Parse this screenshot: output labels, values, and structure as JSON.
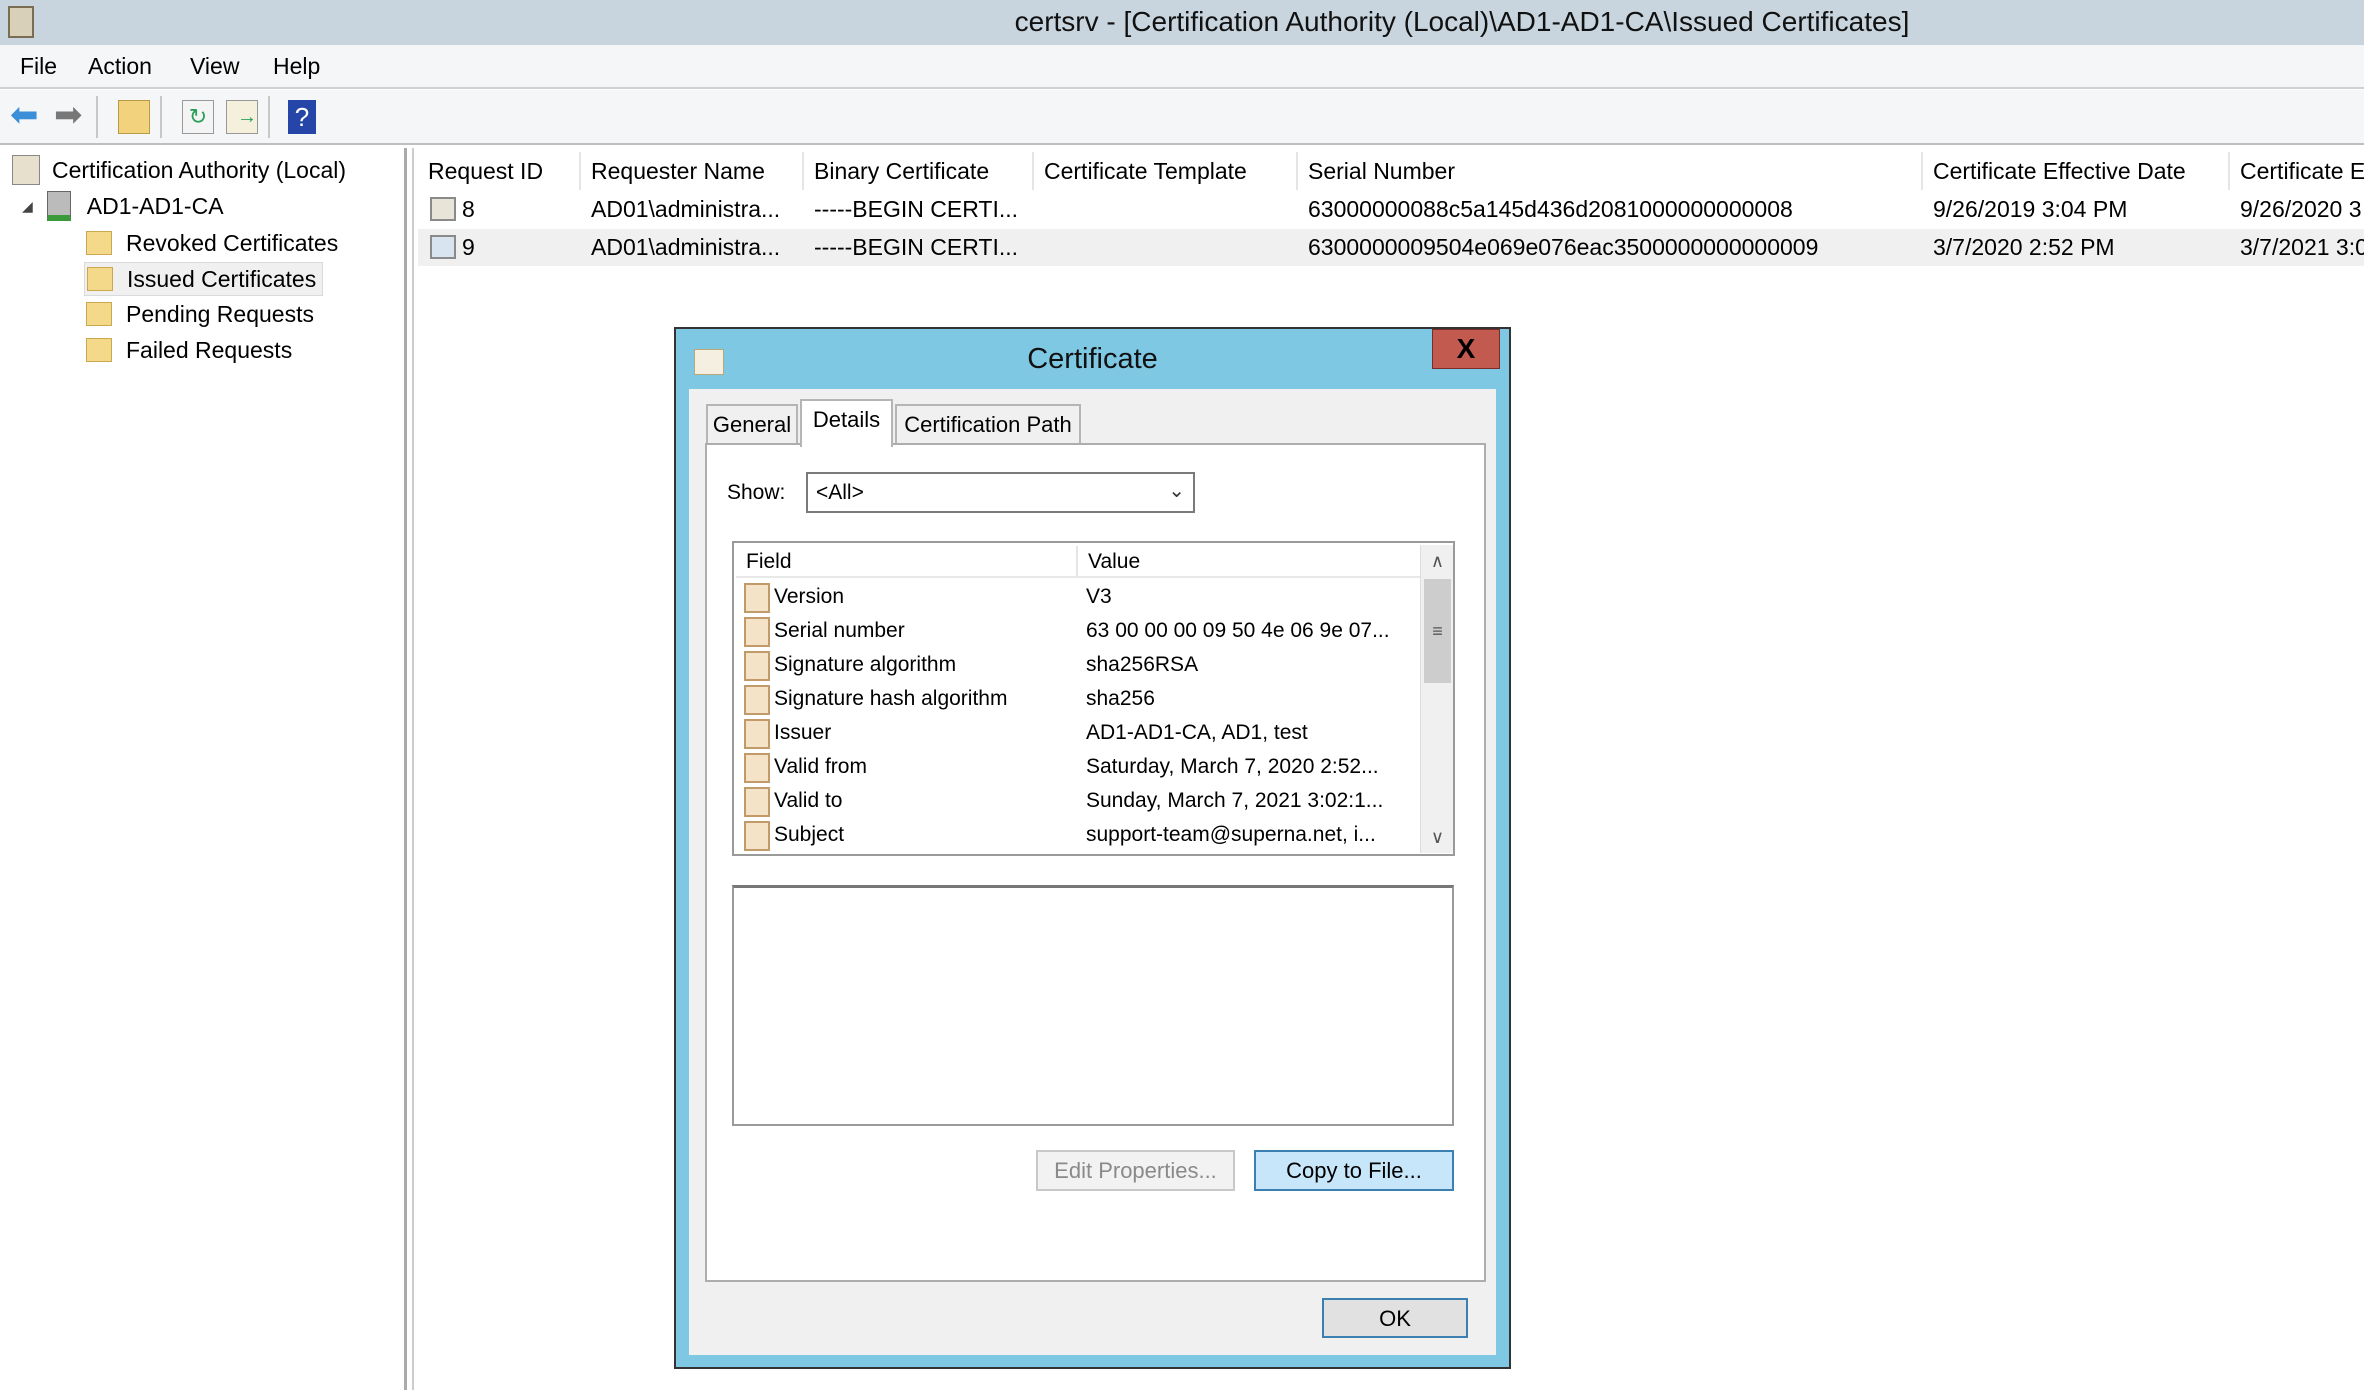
{
  "window": {
    "title": "certsrv - [Certification Authority (Local)\\AD1-AD1-CA\\Issued Certificates]"
  },
  "menu": [
    "File",
    "Action",
    "View",
    "Help"
  ],
  "toolbar": [
    "back-icon",
    "forward-icon",
    "up-folder-icon",
    "refresh-icon",
    "export-list-icon",
    "help-icon"
  ],
  "tree": {
    "root": "Certification Authority (Local)",
    "ca": "AD1-AD1-CA",
    "folders": [
      "Revoked Certificates",
      "Issued Certificates",
      "Pending Requests",
      "Failed Requests"
    ],
    "selected": "Issued Certificates"
  },
  "table": {
    "columns": [
      "Request ID",
      "Requester Name",
      "Binary Certificate",
      "Certificate Template",
      "Serial Number",
      "Certificate Effective Date",
      "Certificate E"
    ],
    "rows": [
      [
        "8",
        "AD01\\administra...",
        "-----BEGIN CERTI...",
        "",
        "63000000088c5a145d436d2081000000000008",
        "9/26/2019 3:04 PM",
        "9/26/2020 3"
      ],
      [
        "9",
        "AD01\\administra...",
        "-----BEGIN CERTI...",
        "",
        "6300000009504e069e076eac3500000000000009",
        "3/7/2020 2:52 PM",
        "3/7/2021 3:0"
      ]
    ]
  },
  "dialog": {
    "title": "Certificate",
    "close": "X",
    "tabs": [
      "General",
      "Details",
      "Certification Path"
    ],
    "active_tab": "Details",
    "show_label": "Show:",
    "show_value": "<All>",
    "field_header": "Field",
    "value_header": "Value",
    "fields": [
      {
        "field": "Version",
        "value": "V3"
      },
      {
        "field": "Serial number",
        "value": "63 00 00 00 09 50 4e 06 9e 07..."
      },
      {
        "field": "Signature algorithm",
        "value": "sha256RSA"
      },
      {
        "field": "Signature hash algorithm",
        "value": "sha256"
      },
      {
        "field": "Issuer",
        "value": "AD1-AD1-CA, AD1, test"
      },
      {
        "field": "Valid from",
        "value": "Saturday, March 7, 2020 2:52..."
      },
      {
        "field": "Valid to",
        "value": "Sunday, March 7, 2021 3:02:1..."
      },
      {
        "field": "Subject",
        "value": "support-team@superna.net, i..."
      }
    ],
    "edit_properties": "Edit Properties...",
    "copy_to_file": "Copy to File...",
    "ok": "OK"
  },
  "colors": {
    "dialog_frame": "#7ec8e3",
    "close": "#c35a50",
    "titlebar": "#c8d5de"
  }
}
